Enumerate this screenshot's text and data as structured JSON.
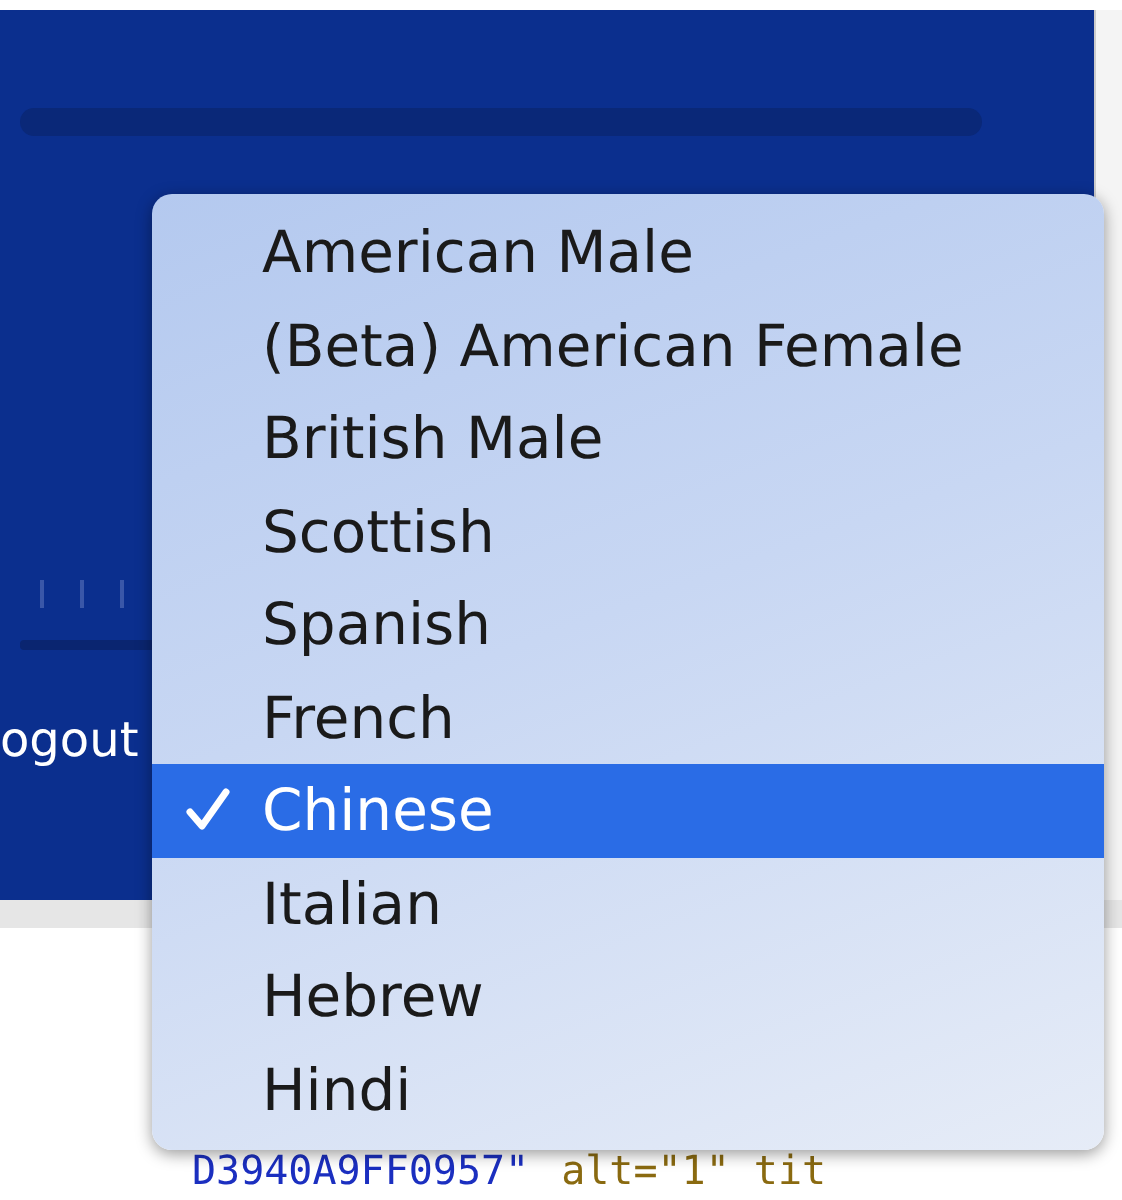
{
  "background": {
    "logout_label": "ogout",
    "code_line": [
      {
        "kind": "value",
        "text": "D3940A9FF0957\""
      },
      {
        "kind": "attr",
        "text": "alt=\"1\" tit"
      }
    ]
  },
  "menu": {
    "items": [
      {
        "label": "American Male",
        "selected": false,
        "checked": false
      },
      {
        "label": "(Beta) American Female",
        "selected": false,
        "checked": false
      },
      {
        "label": "British Male",
        "selected": false,
        "checked": false
      },
      {
        "label": "Scottish",
        "selected": false,
        "checked": false
      },
      {
        "label": "Spanish",
        "selected": false,
        "checked": false
      },
      {
        "label": "French",
        "selected": false,
        "checked": false
      },
      {
        "label": "Chinese",
        "selected": true,
        "checked": true
      },
      {
        "label": "Italian",
        "selected": false,
        "checked": false
      },
      {
        "label": "Hebrew",
        "selected": false,
        "checked": false
      },
      {
        "label": "Hindi",
        "selected": false,
        "checked": false
      }
    ]
  }
}
